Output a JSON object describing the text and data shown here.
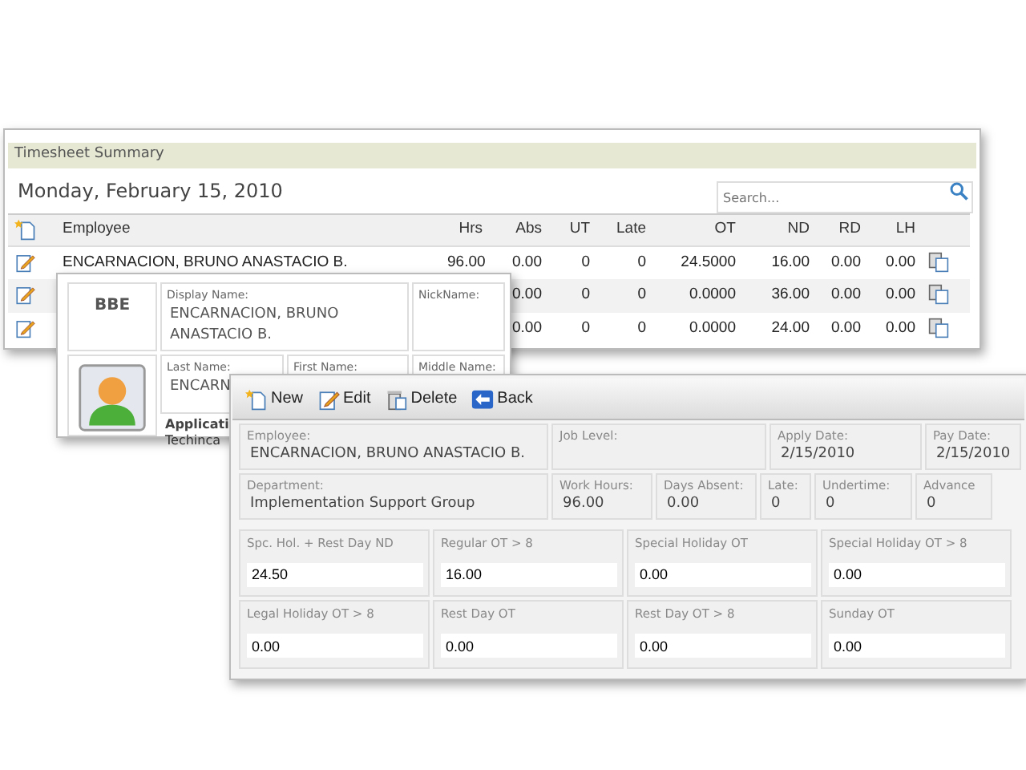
{
  "timesheet_summary": {
    "title": "Timesheet Summary",
    "date": "Monday, February 15, 2010",
    "search": {
      "placeholder": "Search..."
    },
    "columns": [
      "Employee",
      "Hrs",
      "Abs",
      "UT",
      "Late",
      "OT",
      "ND",
      "RD",
      "LH"
    ],
    "rows": [
      {
        "cells": [
          "ENCARNACION, BRUNO ANASTACIO B.",
          "96.00",
          "0.00",
          "0",
          "0",
          "24.5000",
          "16.00",
          "0.00",
          "0.00"
        ]
      },
      {
        "cells": [
          null,
          null,
          "0.00",
          "0",
          "0",
          "0.0000",
          "36.00",
          "0.00",
          "0.00"
        ]
      },
      {
        "cells": [
          null,
          null,
          "0.00",
          "0",
          "0",
          "0.0000",
          "24.00",
          "0.00",
          "0.00"
        ]
      }
    ]
  },
  "employee_card": {
    "code": "BBE",
    "display_name": {
      "label": "Display Name:",
      "value": "ENCARNACION, BRUNO ANASTACIO B."
    },
    "nickname": {
      "label": "NickName:"
    },
    "last_name": {
      "label": "Last Name:",
      "value": "ENCARN"
    },
    "first_name": {
      "label": "First Name:"
    },
    "middle_name": {
      "label": "Middle Name:"
    },
    "application": {
      "label": "Applicati",
      "value": "Techinca"
    }
  },
  "detail_form": {
    "toolbar": [
      {
        "kind": "new",
        "label": "New"
      },
      {
        "kind": "edit",
        "label": "Edit"
      },
      {
        "kind": "delete",
        "label": "Delete"
      },
      {
        "kind": "back",
        "label": "Back"
      }
    ],
    "header_rows": [
      [
        {
          "label": "Employee:",
          "value": "ENCARNACION, BRUNO ANASTACIO B."
        },
        {
          "label": "Job Level:"
        },
        {
          "label": "Apply Date:",
          "value": "2/15/2010"
        },
        {
          "label": "Pay Date:",
          "value": "2/15/2010"
        }
      ],
      [
        {
          "label": "Department:",
          "value": "Implementation Support Group"
        },
        {
          "label": "Work Hours:",
          "value": "96.00"
        },
        {
          "label": "Days Absent:",
          "value": "0.00"
        },
        {
          "label": "Late:",
          "value": "0"
        },
        {
          "label": "Undertime:",
          "value": "0"
        },
        {
          "label": "Advance",
          "value": "0"
        }
      ]
    ],
    "ot_rows": [
      [
        {
          "label": "Spc. Hol. + Rest Day ND",
          "value": "24.50"
        },
        {
          "label": "Regular OT > 8",
          "value": "16.00"
        },
        {
          "label": "Special Holiday OT",
          "value": "0.00"
        },
        {
          "label": "Special Holiday OT > 8",
          "value": "0.00"
        }
      ],
      [
        {
          "label": "Legal Holiday OT > 8",
          "value": "0.00"
        },
        {
          "label": "Rest Day OT",
          "value": "0.00"
        },
        {
          "label": "Rest Day OT > 8",
          "value": "0.00"
        },
        {
          "label": "Sunday OT",
          "value": "0.00"
        }
      ]
    ]
  }
}
